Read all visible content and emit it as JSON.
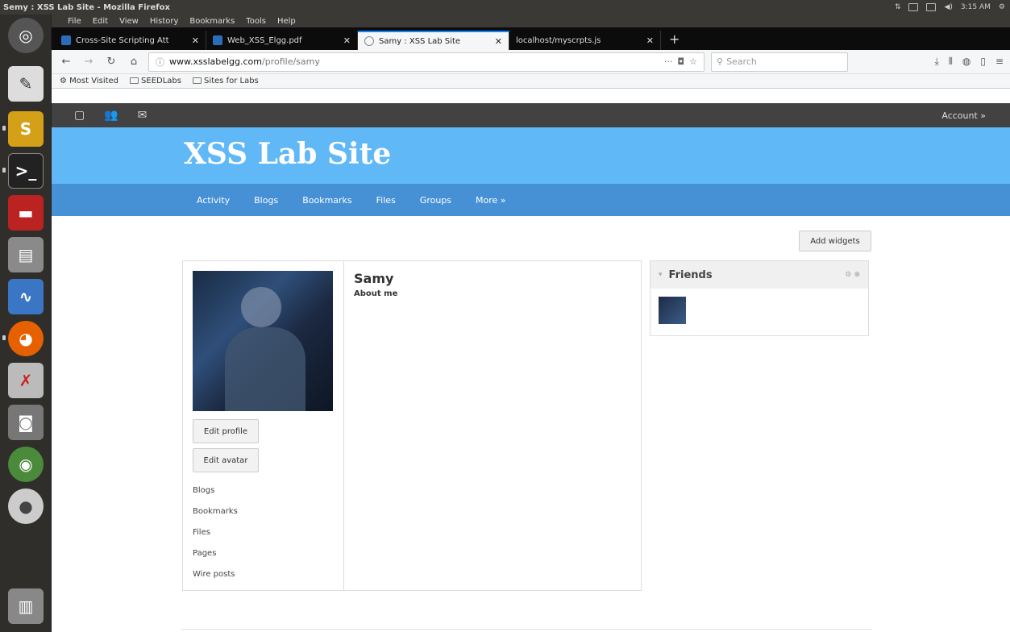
{
  "os": {
    "window_title": "Semy : XSS Lab Site - Mozilla Firefox",
    "clock": "3:15 AM"
  },
  "browser": {
    "menu": [
      "File",
      "Edit",
      "View",
      "History",
      "Bookmarks",
      "Tools",
      "Help"
    ],
    "tabs": [
      {
        "label": "Cross-Site Scripting Att"
      },
      {
        "label": "Web_XSS_Elgg.pdf"
      },
      {
        "label": "Samy : XSS Lab Site"
      },
      {
        "label": "localhost/myscrpts.js"
      }
    ],
    "url": {
      "scheme_host": "www.xsslabelgg.com",
      "path": "/profile/samy"
    },
    "search_placeholder": "Search",
    "bookmarks": [
      "Most Visited",
      "SEEDLabs",
      "Sites for Labs"
    ]
  },
  "site": {
    "name": "XSS Lab Site",
    "account": "Account »",
    "nav": [
      "Activity",
      "Blogs",
      "Bookmarks",
      "Files",
      "Groups",
      "More »"
    ],
    "add_widgets": "Add widgets"
  },
  "profile": {
    "name": "Samy",
    "about_label": "About me",
    "edit_profile": "Edit profile",
    "edit_avatar": "Edit avatar",
    "links": [
      "Blogs",
      "Bookmarks",
      "Files",
      "Pages",
      "Wire posts"
    ]
  },
  "friends_widget": {
    "title": "Friends"
  },
  "colors": {
    "header": "#60b8f7",
    "menu": "#4690d6",
    "topbar": "#424242"
  }
}
